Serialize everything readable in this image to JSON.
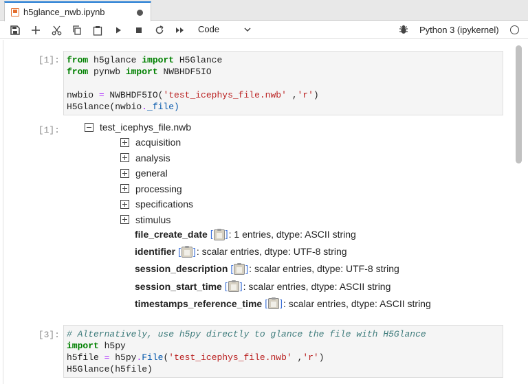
{
  "tab": {
    "title": "h5glance_nwb.ipynb"
  },
  "toolbar": {
    "cell_type": "Code",
    "kernel_name": "Python 3 (ipykernel)",
    "icons": [
      "save-icon",
      "add-icon",
      "cut-icon",
      "copy-icon",
      "paste-icon",
      "run-icon",
      "stop-icon",
      "restart-icon",
      "fast-forward-icon",
      "debugger-icon",
      "kernel-status-icon"
    ]
  },
  "cells": {
    "c1": {
      "prompt": "[1]:",
      "lines": [
        [
          {
            "t": "from",
            "c": "kw"
          },
          {
            "t": " h5glance ",
            "c": ""
          },
          {
            "t": "import",
            "c": "kw"
          },
          {
            "t": " H5Glance",
            "c": ""
          }
        ],
        [
          {
            "t": "from",
            "c": "kw"
          },
          {
            "t": " pynwb ",
            "c": ""
          },
          {
            "t": "import",
            "c": "kw"
          },
          {
            "t": " NWBHDF5IO",
            "c": ""
          }
        ],
        [],
        [
          {
            "t": "nwbio ",
            "c": ""
          },
          {
            "t": "=",
            "c": "op"
          },
          {
            "t": " NWBHDF5IO(",
            "c": ""
          },
          {
            "t": "'test_icephys_file.nwb'",
            "c": "str"
          },
          {
            "t": " ,",
            "c": ""
          },
          {
            "t": "'r'",
            "c": "str"
          },
          {
            "t": ")",
            "c": ""
          }
        ],
        [
          {
            "t": "H5Glance(nwbio",
            "c": ""
          },
          {
            "t": ".",
            "c": "op"
          },
          {
            "t": "_file)",
            "c": "attr"
          }
        ]
      ]
    },
    "out1": {
      "prompt": "[1]:",
      "root": "test_icephys_file.nwb",
      "groups": [
        "acquisition",
        "analysis",
        "general",
        "processing",
        "specifications",
        "stimulus"
      ],
      "attributes": [
        {
          "name": "file_create_date",
          "desc": ": 1 entries, dtype: ASCII string"
        },
        {
          "name": "identifier",
          "desc": ": scalar entries, dtype: UTF-8 string"
        },
        {
          "name": "session_description",
          "desc": ": scalar entries, dtype: UTF-8 string"
        },
        {
          "name": "session_start_time",
          "desc": ": scalar entries, dtype: ASCII string"
        },
        {
          "name": "timestamps_reference_time",
          "desc": ": scalar entries, dtype: ASCII string"
        }
      ]
    },
    "c3": {
      "prompt": "[3]:",
      "lines": [
        [
          {
            "t": "# Alternatively, use h5py directly to glance the file with H5Glance",
            "c": "com"
          }
        ],
        [
          {
            "t": "import",
            "c": "kw"
          },
          {
            "t": " h5py",
            "c": ""
          }
        ],
        [
          {
            "t": "h5file ",
            "c": ""
          },
          {
            "t": "=",
            "c": "op"
          },
          {
            "t": " h5py",
            "c": ""
          },
          {
            "t": ".",
            "c": "op"
          },
          {
            "t": "File",
            "c": "attr"
          },
          {
            "t": "(",
            "c": ""
          },
          {
            "t": "'test_icephys_file.nwb'",
            "c": "str"
          },
          {
            "t": " ,",
            "c": ""
          },
          {
            "t": "'r'",
            "c": "str"
          },
          {
            "t": ")",
            "c": ""
          }
        ],
        [
          {
            "t": "H5Glance(h5file)",
            "c": ""
          }
        ]
      ]
    }
  },
  "colors": {
    "accent": "#1976d2",
    "keyword": "#008000",
    "string": "#ba2121",
    "operator": "#aa22ff",
    "comment": "#3d7b7b",
    "bracket": "#3b6fd6"
  }
}
